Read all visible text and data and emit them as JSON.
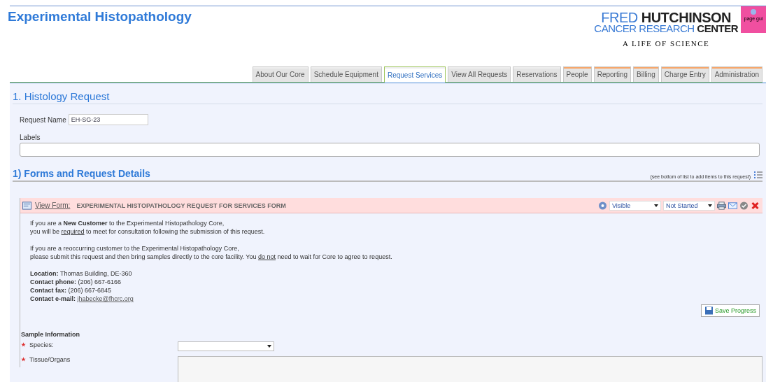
{
  "header": {
    "title": "Experimental Histopathology",
    "logo": {
      "line1a": "FRED",
      "line1b": "HUTCHINSON",
      "line2a": "CANCER RESEARCH",
      "line2b": "CENTER",
      "tagline": "A LIFE OF SCIENCE"
    },
    "page_guide": "page gui"
  },
  "tabs": [
    {
      "label": "About Our Core",
      "selected": false,
      "kind": "core"
    },
    {
      "label": "Schedule Equipment",
      "selected": false,
      "kind": "core"
    },
    {
      "label": "Request Services",
      "selected": true,
      "kind": "core"
    },
    {
      "label": "View All Requests",
      "selected": false,
      "kind": "core"
    },
    {
      "label": "Reservations",
      "selected": false,
      "kind": "core"
    },
    {
      "label": "People",
      "selected": false,
      "kind": "admin"
    },
    {
      "label": "Reporting",
      "selected": false,
      "kind": "admin"
    },
    {
      "label": "Billing",
      "selected": false,
      "kind": "admin"
    },
    {
      "label": "Charge Entry",
      "selected": false,
      "kind": "admin"
    },
    {
      "label": "Administration",
      "selected": false,
      "kind": "admin"
    }
  ],
  "request": {
    "heading": "1. Histology Request",
    "name_label": "Request Name",
    "name_value": "EH-SG-23",
    "labels_label": "Labels"
  },
  "forms": {
    "heading": "1) Forms and Request Details",
    "hint": "(see bottom of list to add items to this request)",
    "form": {
      "view_link": "View Form:",
      "title": "EXPERIMENTAL HISTOPATHOLOGY REQUEST FOR SERVICES FORM",
      "visibility": "Visible",
      "status": "Not Started",
      "paragraphs": [
        {
          "lines": [
            [
              {
                "text": "If you are a ",
                "kind": "plain"
              },
              {
                "text": "New Customer",
                "kind": "bold"
              },
              {
                "text": " to the Experimental Histopathology Core,",
                "kind": "plain"
              }
            ],
            [
              {
                "text": "you will be ",
                "kind": "plain"
              },
              {
                "text": "required",
                "kind": "underline"
              },
              {
                "text": " to meet for consultation following the submission of this request.",
                "kind": "plain"
              }
            ]
          ]
        },
        {
          "lines": [
            [
              {
                "text": "If you are a reoccurring customer to the Experimental Histopathology Core,",
                "kind": "plain"
              }
            ],
            [
              {
                "text": "please submit this request and then bring samples directly to the core facility. You ",
                "kind": "plain"
              },
              {
                "text": "do not",
                "kind": "underline"
              },
              {
                "text": " need to wait for Core to agree to request.",
                "kind": "plain"
              }
            ]
          ]
        }
      ],
      "contacts": [
        {
          "label": "Location:",
          "value": "Thomas Building, DE-360"
        },
        {
          "label": "Contact phone:",
          "value": "(206) 667-6166"
        },
        {
          "label": "Contact fax:",
          "value": "(206) 667-6845"
        },
        {
          "label": "Contact e-mail:",
          "value": "jhabecke@fhcrc.org",
          "link": true
        }
      ],
      "save_button": "Save Progress",
      "section": "Sample Information",
      "fields": [
        {
          "label": "Species:",
          "required": true,
          "kind": "select"
        },
        {
          "label": "Tissue/Organs",
          "required": true,
          "kind": "textarea"
        }
      ]
    }
  }
}
